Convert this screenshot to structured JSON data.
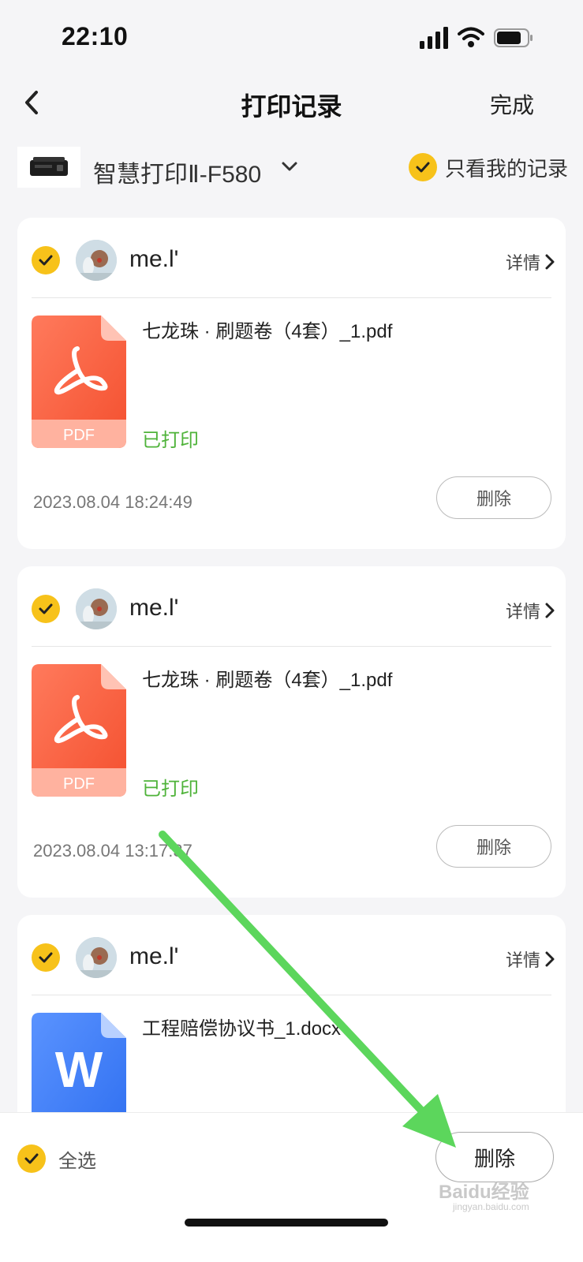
{
  "status_bar": {
    "time": "22:10"
  },
  "nav": {
    "title": "打印记录",
    "done_label": "完成"
  },
  "device": {
    "name": "智慧打印Ⅱ-F580",
    "mine_only_label": "只看我的记录"
  },
  "records": [
    {
      "user": "me.l'",
      "detail_label": "详情",
      "file_name": "七龙珠 · 刷题卷（4套）_1.pdf",
      "file_type": "PDF",
      "status": "已打印",
      "timestamp": "2023.08.04 18:24:49",
      "delete_label": "删除"
    },
    {
      "user": "me.l'",
      "detail_label": "详情",
      "file_name": "七龙珠 · 刷题卷（4套）_1.pdf",
      "file_type": "PDF",
      "status": "已打印",
      "timestamp": "2023.08.04 13:17:37",
      "delete_label": "删除"
    },
    {
      "user": "me.l'",
      "detail_label": "详情",
      "file_name": "工程赔偿协议书_1.docx",
      "file_type": "W",
      "status": "",
      "timestamp": "",
      "delete_label": ""
    }
  ],
  "bottom_bar": {
    "select_all_label": "全选",
    "delete_label": "删除"
  },
  "watermark": {
    "text": "Baidu经验",
    "sub": "jingyan.baidu.com"
  },
  "colors": {
    "accent": "#f7c21a",
    "status_green": "#4fb33a",
    "pdf_red": "#fa5a3c",
    "word_blue": "#3d7cf5",
    "annotation_arrow": "#5cd65c"
  }
}
